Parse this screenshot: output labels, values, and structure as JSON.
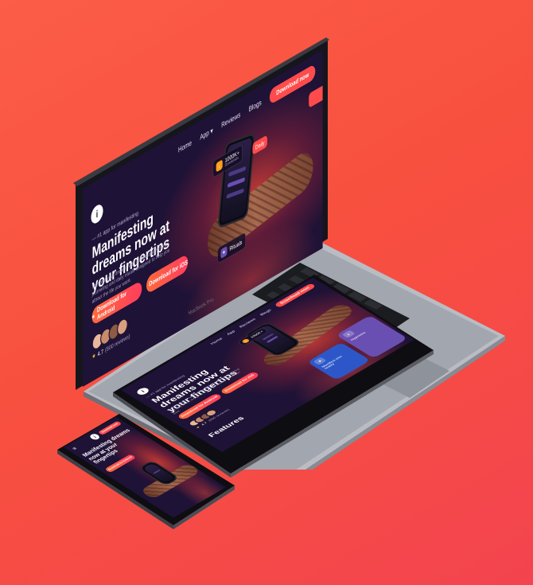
{
  "device_labels": {
    "laptop_model": "MacBook Pro"
  },
  "site": {
    "nav": {
      "home": "Home",
      "app": "App",
      "reviews": "Reviews",
      "blogs": "Blogs",
      "download": "Download now"
    },
    "logo_glyph": "i",
    "kicker": "— #1 app for manifesting",
    "headline": "Manifesting dreams now at your fingertips",
    "subtext": "Manifest your dreams with guided affirmations, journaling and daily rituals designed to help you attract the life you want.",
    "cta_android": "Download for Android",
    "cta_ios": "Download for iOS",
    "rating_score": "4.7",
    "rating_reviews": "(800 reviews)",
    "rating_source": "",
    "badge_downloads": "1000K+",
    "badge_downloads_sub": "Downloads",
    "badge_side": "Daily",
    "badge_small": "Rituals",
    "features_title": "Features",
    "card_manifest": "Manifest into reality",
    "card_journal": "Journal",
    "card_hypno": "Hypnosis"
  },
  "colors": {
    "background": "#f8503f",
    "site_bg": "#1e1236",
    "accent": "#ff4b4b"
  },
  "icons": {
    "android": "android-icon",
    "apple": "apple-icon",
    "star": "star-icon",
    "chevron": "chevron-down-icon",
    "menu": "hamburger-icon"
  }
}
